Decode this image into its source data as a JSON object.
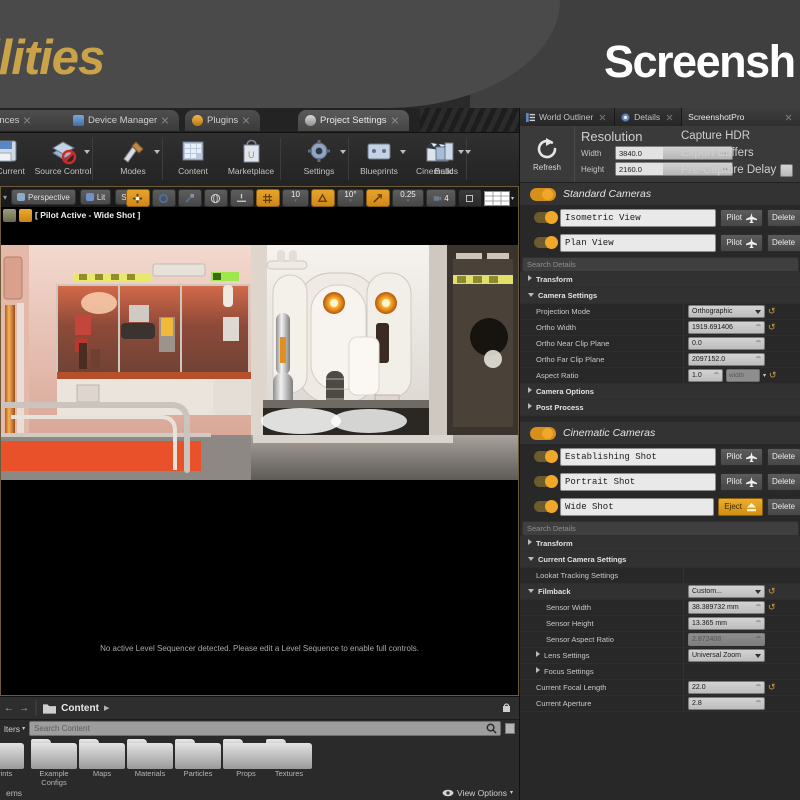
{
  "banner": {
    "left_title": "ilities",
    "right_title": "Screensh",
    "gold": "#c9a249"
  },
  "window_tabs": [
    {
      "label": "ferences"
    },
    {
      "label": "Device Manager"
    },
    {
      "label": "Plugins"
    },
    {
      "label": "Project Settings"
    }
  ],
  "main_toolbar": [
    {
      "label": "ve Current",
      "icon": "save-icon",
      "caret": false
    },
    {
      "label": "Source Control",
      "icon": "source-control-icon",
      "caret": true
    },
    {
      "label": "Modes",
      "icon": "modes-icon",
      "caret": true
    },
    {
      "label": "Content",
      "icon": "content-icon",
      "caret": false
    },
    {
      "label": "Marketplace",
      "icon": "marketplace-icon",
      "caret": false
    },
    {
      "label": "Settings",
      "icon": "settings-icon",
      "caret": true
    },
    {
      "label": "Blueprints",
      "icon": "blueprints-icon",
      "caret": true
    },
    {
      "label": "Cinematics",
      "icon": "cinematics-icon",
      "caret": true
    },
    {
      "label": "Build",
      "icon": "build-icon",
      "caret": true
    }
  ],
  "main_toolbar_overflow": "»",
  "viewport": {
    "chips": [
      {
        "label": "Perspective",
        "icon": "camera-icon"
      },
      {
        "label": "Lit",
        "icon": "lighting-icon"
      },
      {
        "label": "Show",
        "icon": ""
      }
    ],
    "transform_tools": [
      {
        "name": "select-translate-icon",
        "state": "on",
        "label": ""
      },
      {
        "name": "rotate-icon",
        "state": "off",
        "label": ""
      },
      {
        "name": "scale-icon",
        "state": "off",
        "label": ""
      },
      {
        "name": "world-coords-icon",
        "state": "off",
        "label": ""
      },
      {
        "name": "surface-snap-icon",
        "state": "off",
        "label": ""
      },
      {
        "name": "grid-snap-icon",
        "state": "on",
        "label": ""
      },
      {
        "name": "grid-size-value",
        "state": "off",
        "label": "10"
      },
      {
        "name": "rotation-snap-icon",
        "state": "on",
        "label": ""
      },
      {
        "name": "rotation-snap-value",
        "state": "off",
        "label": "10°"
      },
      {
        "name": "scale-snap-icon",
        "state": "on",
        "label": ""
      },
      {
        "name": "scale-snap-value",
        "state": "off",
        "label": "0.25"
      },
      {
        "name": "camera-speed-icon",
        "state": "off",
        "label": "4"
      }
    ],
    "maximize_icon": "maximize-icon",
    "layout_icon": "viewport-layout-icon",
    "pilot_label": "[ Pilot Active - Wide Shot ]",
    "message": "No active Level Sequencer detected. Please edit a Level Sequence to enable full controls."
  },
  "content_browser": {
    "path_label": "Content",
    "filters_label": "lters",
    "search_placeholder": "Search Content",
    "folders": [
      "eprints",
      "Example Configs",
      "Maps",
      "Materials",
      "Particles",
      "Props",
      "Textures"
    ],
    "status_items": "ems",
    "view_options": "View Options"
  },
  "dock": {
    "tabs": [
      {
        "label": "World Outliner",
        "icon": "outliner-icon",
        "active": false
      },
      {
        "label": "Details",
        "icon": "details-icon",
        "active": false
      },
      {
        "label": "ScreenshotPro",
        "icon": "",
        "active": true
      }
    ],
    "capture_header": {
      "refresh_label": "Refresh",
      "refresh_icon": "refresh-icon",
      "resolution_title": "Resolution",
      "width_label": "Width",
      "width_value": "3840.0",
      "height_label": "Height",
      "height_value": "2160.0",
      "options": [
        {
          "label": "Capture HDR",
          "checked": false
        },
        {
          "label": "Export Buffers",
          "checked": false
        },
        {
          "label": "Pre-Capture Delay",
          "checked": true
        }
      ]
    },
    "standard_cameras": {
      "section_label": "Standard Cameras",
      "toggle": "on",
      "cameras": [
        {
          "name": "Isometric View",
          "action": "Pilot",
          "action_icon": "plane-icon",
          "delete": "Delete",
          "active": false
        },
        {
          "name": "Plan View",
          "action": "Pilot",
          "action_icon": "plane-icon",
          "delete": "Delete",
          "active": false
        }
      ],
      "search_placeholder": "Search Details",
      "properties": [
        {
          "kind": "cat",
          "label": "Transform",
          "tri": "closed"
        },
        {
          "kind": "cat",
          "label": "Camera Settings",
          "tri": "open"
        },
        {
          "kind": "select",
          "label": "Projection Mode",
          "value": "Orthographic",
          "reset": true
        },
        {
          "kind": "num",
          "label": "Ortho Width",
          "value": "1919.691406",
          "reset": true
        },
        {
          "kind": "num",
          "label": "Ortho Near Clip Plane",
          "value": "0.0",
          "reset": false
        },
        {
          "kind": "num",
          "label": "Ortho Far Clip Plane",
          "value": "2097152.0",
          "reset": false
        },
        {
          "kind": "ratio",
          "label": "Aspect Ratio",
          "value": "1.0",
          "slot": "width",
          "reset": true
        },
        {
          "kind": "cat",
          "label": "Camera Options",
          "tri": "closed"
        },
        {
          "kind": "cat",
          "label": "Post Process",
          "tri": "closed"
        }
      ]
    },
    "cinematic_cameras": {
      "section_label": "Cinematic Cameras",
      "toggle": "on",
      "cameras": [
        {
          "name": "Establishing Shot",
          "action": "Pilot",
          "action_icon": "plane-icon",
          "delete": "Delete",
          "active": false
        },
        {
          "name": "Portrait Shot",
          "action": "Pilot",
          "action_icon": "plane-icon",
          "delete": "Delete",
          "active": false
        },
        {
          "name": "Wide Shot",
          "action": "Eject",
          "action_icon": "eject-icon",
          "delete": "Delete",
          "active": true
        }
      ],
      "search_placeholder": "Search Details",
      "properties": [
        {
          "kind": "cat",
          "label": "Transform",
          "tri": "closed"
        },
        {
          "kind": "cat",
          "label": "Current Camera Settings",
          "tri": "open"
        },
        {
          "kind": "plain",
          "label": "Lookat Tracking Settings"
        },
        {
          "kind": "selcat",
          "label": "Filmback",
          "tri": "open",
          "value": "Custom...",
          "reset": true
        },
        {
          "kind": "num-ind",
          "label": "Sensor Width",
          "value": "38.389732 mm",
          "reset": true
        },
        {
          "kind": "num-ind",
          "label": "Sensor Height",
          "value": "13.365 mm",
          "reset": false
        },
        {
          "kind": "num-ind-dis",
          "label": "Sensor Aspect Ratio",
          "value": "2.872408",
          "reset": false
        },
        {
          "kind": "selcat2",
          "label": "Lens Settings",
          "tri": "closed",
          "value": "Universal Zoom"
        },
        {
          "kind": "cat",
          "label": "Focus Settings",
          "tri": "closed"
        },
        {
          "kind": "num",
          "label": "Current Focal Length",
          "value": "22.0",
          "reset": true
        },
        {
          "kind": "num",
          "label": "Current Aperture",
          "value": "2.8",
          "reset": false
        }
      ]
    }
  }
}
